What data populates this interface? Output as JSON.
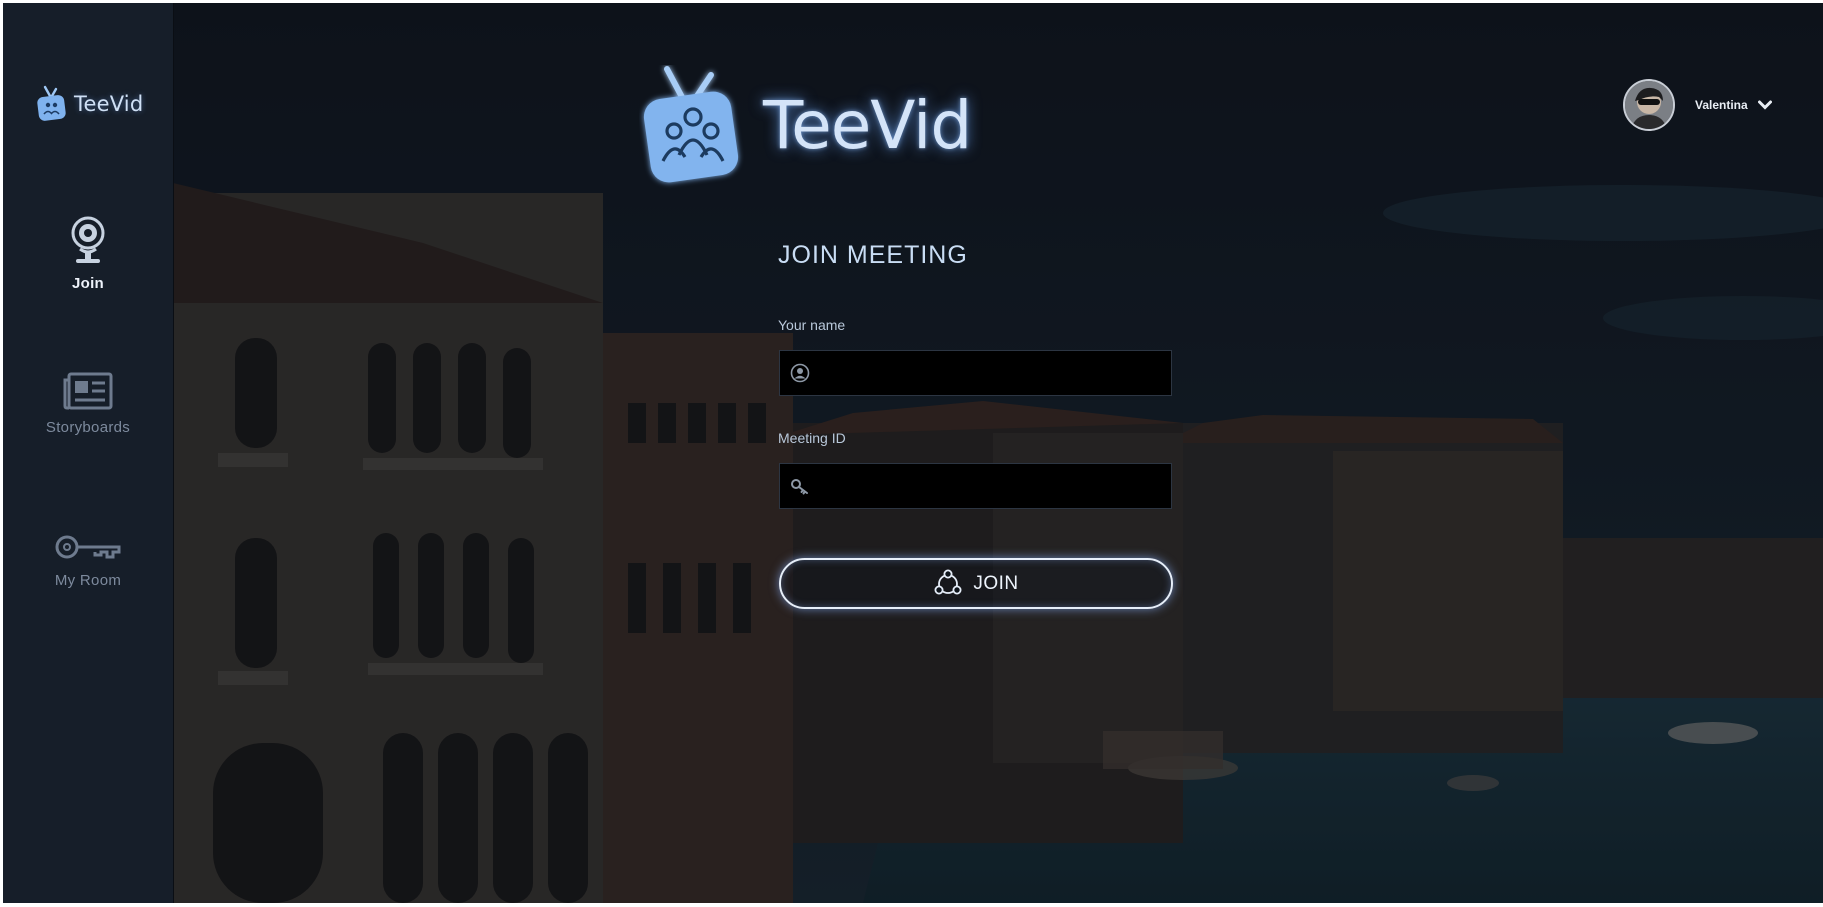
{
  "app": {
    "brand": "TeeVid"
  },
  "sidebar": {
    "items": [
      {
        "label": "Join",
        "icon": "webcam-icon",
        "active": true
      },
      {
        "label": "Storyboards",
        "icon": "newspaper-icon",
        "active": false
      },
      {
        "label": "My Room",
        "icon": "key-icon",
        "active": false
      }
    ]
  },
  "user": {
    "name": "Valentina",
    "avatar": "avatar"
  },
  "form": {
    "title": "JOIN MEETING",
    "name_label": "Your name",
    "name_value": "",
    "meeting_label": "Meeting ID",
    "meeting_value": "",
    "join_label": "JOIN"
  },
  "colors": {
    "sidebar_bg": "#161e29",
    "accent_glow": "#8fb8ff",
    "logo_blue": "#7fb2ee",
    "text_light": "#c9ddf4"
  }
}
